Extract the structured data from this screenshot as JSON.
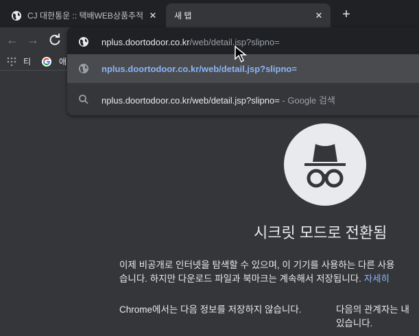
{
  "tabs": [
    {
      "title": "CJ 대한통운 :: 택배WEB상품추적",
      "icon": "globe-icon",
      "active": false
    },
    {
      "title": "새 탭",
      "icon": "",
      "active": true
    }
  ],
  "new_tab_symbol": "+",
  "bookmarks": [
    {
      "label": "티",
      "icon": "apps-grid-icon"
    },
    {
      "label": "애",
      "icon": "google-icon"
    }
  ],
  "omnibox": {
    "input_host": "nplus.doortodoor.co.kr",
    "input_path": "/web/detail.jsp?slipno=",
    "suggestions": [
      {
        "icon": "globe-icon",
        "text": "nplus.doortodoor.co.kr/web/detail.jsp?slipno=",
        "suffix": ""
      },
      {
        "icon": "search-icon",
        "text": "nplus.doortodoor.co.kr/web/detail.jsp?slipno=",
        "suffix": " - Google 검색"
      }
    ]
  },
  "incognito": {
    "headline": "시크릿 모드로 전환됨",
    "para_line1": "이제 비공개로 인터넷을 탐색할 수 있으며, 이 기기를 사용하는 다른 사용",
    "para_line2": "습니다. 하지만 다운로드 파일과 북마크는 계속해서 저장됩니다.",
    "learn_more": " 자세히",
    "col1_text": "Chrome에서는 다음 정보를 저장하지 않습니다.",
    "col2_line1": "다음의 관계자는 내",
    "col2_line2": "있습니다."
  },
  "colors": {
    "tabbar": "#202124",
    "toolbar": "#35363a",
    "accent": "#8ab4f8",
    "text": "#e8eaed"
  }
}
